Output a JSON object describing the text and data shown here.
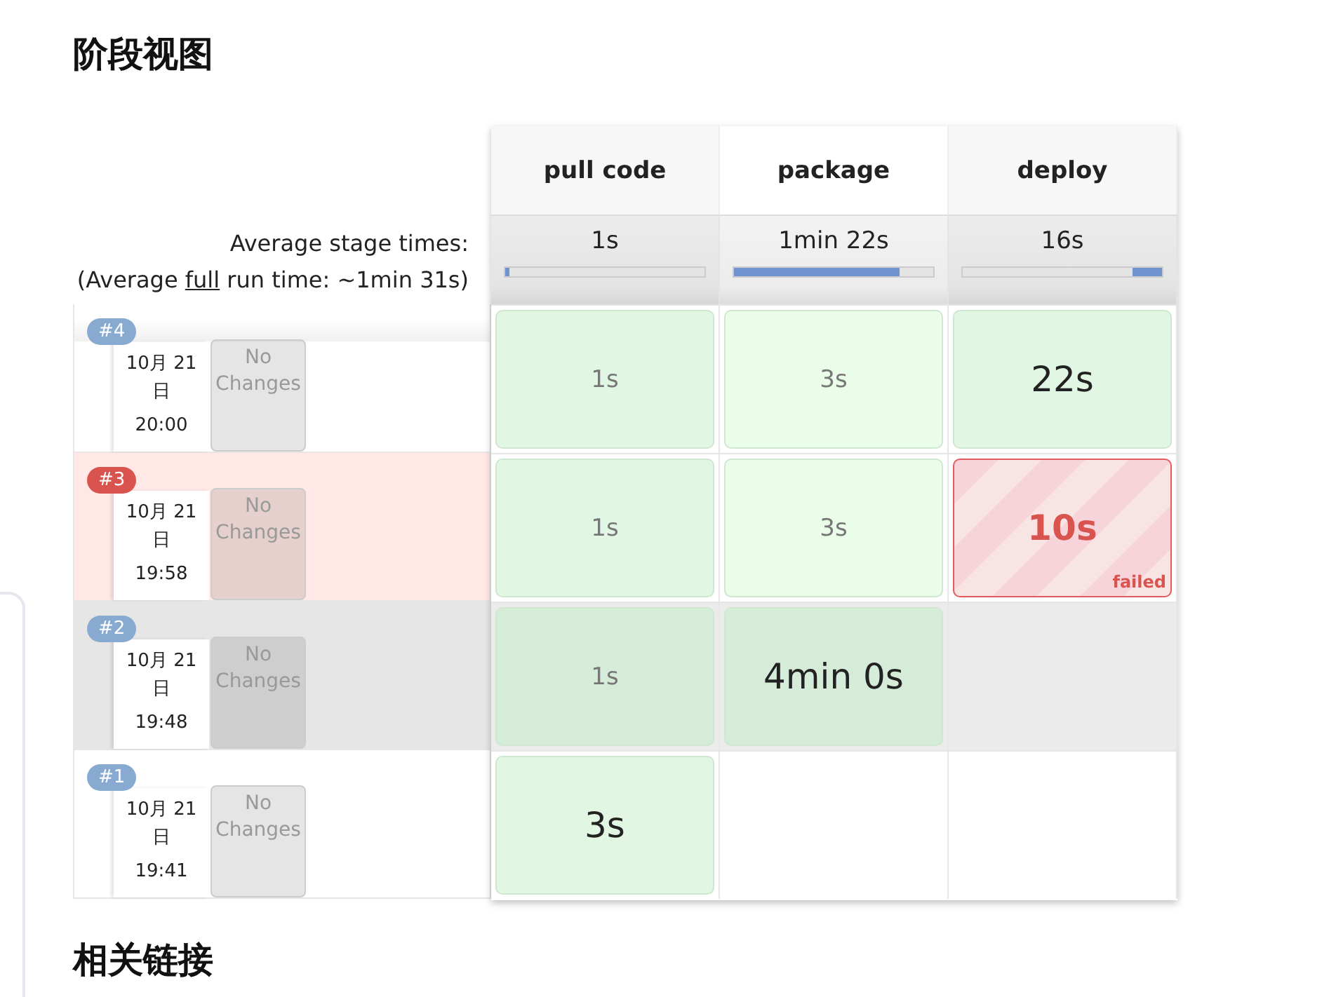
{
  "title": "阶段视图",
  "stages": [
    {
      "name": "pull code",
      "avg": "1s",
      "from_end": false,
      "level": 0.02
    },
    {
      "name": "package",
      "avg": "1min 22s",
      "from_end": false,
      "level": 0.83
    },
    {
      "name": "deploy",
      "avg": "16s",
      "from_end": true,
      "level": 0.15
    }
  ],
  "average": {
    "label": "Average stage times:",
    "full_prefix": "(Average ",
    "full_link": "full",
    "full_suffix": " run time: ~1min 31s)"
  },
  "builds": [
    {
      "number": "#4",
      "failed": false,
      "hovered": false,
      "date": "10月 21 日",
      "time": "20:00",
      "changes": "No Changes",
      "cells": [
        {
          "kind": "success",
          "text": "1s",
          "large": false
        },
        {
          "kind": "success",
          "text": "3s",
          "large": false
        },
        {
          "kind": "success",
          "text": "22s",
          "large": true
        }
      ]
    },
    {
      "number": "#3",
      "failed": true,
      "hovered": false,
      "date": "10月 21 日",
      "time": "19:58",
      "changes": "No Changes",
      "cells": [
        {
          "kind": "success",
          "text": "1s",
          "large": false
        },
        {
          "kind": "success",
          "text": "3s",
          "large": false
        },
        {
          "kind": "failed",
          "text": "10s",
          "large": true,
          "status_label": "failed"
        }
      ]
    },
    {
      "number": "#2",
      "failed": false,
      "hovered": true,
      "date": "10月 21 日",
      "time": "19:48",
      "changes": "No Changes",
      "cells": [
        {
          "kind": "success",
          "text": "1s",
          "large": false
        },
        {
          "kind": "success",
          "text": "4min 0s",
          "large": true
        },
        {
          "kind": "empty"
        }
      ]
    },
    {
      "number": "#1",
      "failed": false,
      "hovered": false,
      "date": "10月 21 日",
      "time": "19:41",
      "changes": "No Changes",
      "cells": [
        {
          "kind": "success",
          "text": "3s",
          "large": true
        },
        {
          "kind": "empty"
        },
        {
          "kind": "empty"
        }
      ]
    }
  ],
  "links_title": "相关链接"
}
